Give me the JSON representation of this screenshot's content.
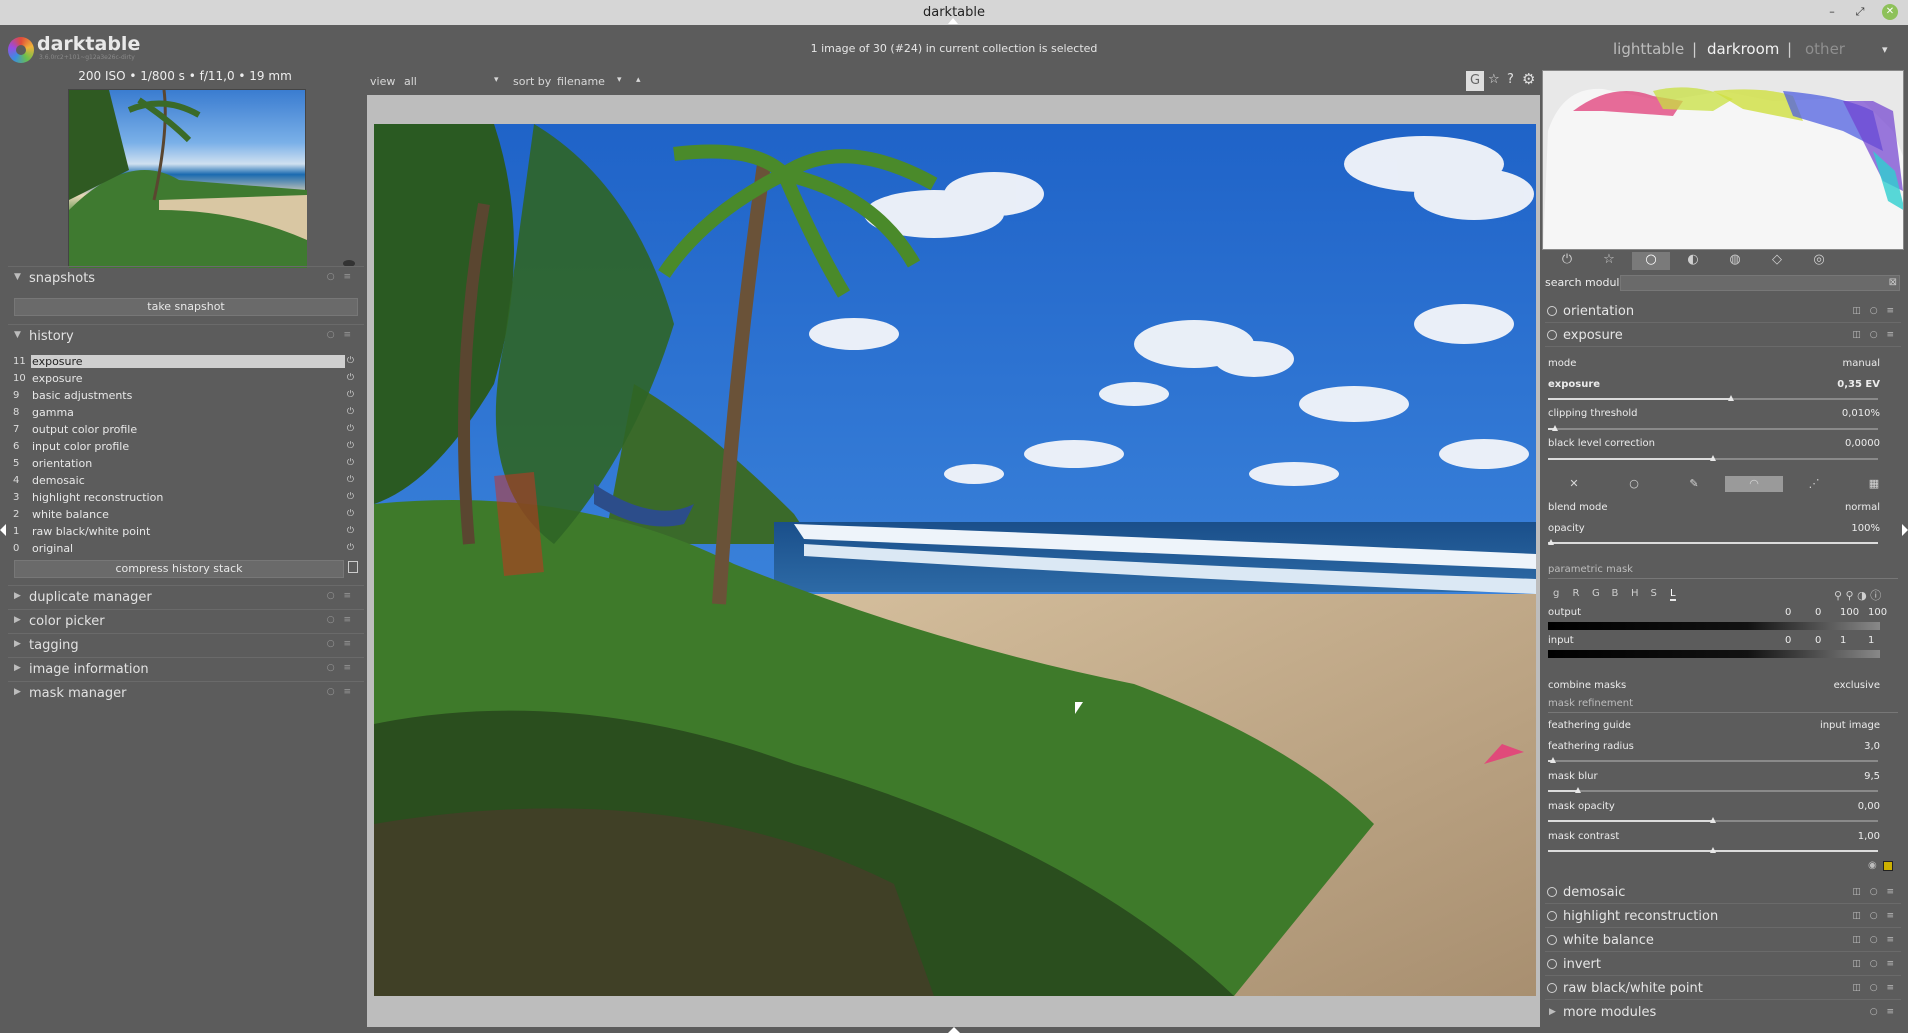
{
  "window": {
    "title": "darktable",
    "min": "–",
    "max": "⤢",
    "close": "✕"
  },
  "header": {
    "app_name": "darktable",
    "version": "3.6.0rc2+101~g12a3e26c-dirty",
    "selection_status": "1 image of 30 (#24) in current collection is selected",
    "views": [
      "lighttable",
      "darkroom",
      "other"
    ],
    "active_view": "darkroom",
    "separator": "|",
    "menu_arrow": "▾"
  },
  "exif": "200 ISO • 1/800 s • f/11,0 • 19 mm",
  "filter_bar": {
    "view_label": "view",
    "view_value": "all",
    "sort_label": "sort by",
    "sort_value": "filename",
    "dd": "▾",
    "sort_dir": "▴"
  },
  "left": {
    "snapshots": {
      "title": "snapshots",
      "take_snapshot": "take snapshot"
    },
    "history": {
      "title": "history",
      "items": [
        {
          "num": "11",
          "name": "exposure",
          "selected": true
        },
        {
          "num": "10",
          "name": "exposure"
        },
        {
          "num": "9",
          "name": "basic adjustments"
        },
        {
          "num": "8",
          "name": "gamma"
        },
        {
          "num": "7",
          "name": "output color profile"
        },
        {
          "num": "6",
          "name": "input color profile"
        },
        {
          "num": "5",
          "name": "orientation"
        },
        {
          "num": "4",
          "name": "demosaic"
        },
        {
          "num": "3",
          "name": "highlight reconstruction"
        },
        {
          "num": "2",
          "name": "white balance"
        },
        {
          "num": "1",
          "name": "raw black/white point"
        },
        {
          "num": "0",
          "name": "original"
        }
      ],
      "compress": "compress history stack"
    },
    "modules": [
      "duplicate manager",
      "color picker",
      "tagging",
      "image information",
      "mask manager"
    ]
  },
  "right": {
    "search_label": "search module",
    "modules_top": [
      "orientation",
      "exposure"
    ],
    "exposure": {
      "mode_label": "mode",
      "mode_value": "manual",
      "exposure_label": "exposure",
      "exposure_value": "0,35 EV",
      "clip_label": "clipping threshold",
      "clip_value": "0,010%",
      "black_label": "black level correction",
      "black_value": "0,0000",
      "blend_label": "blend mode",
      "blend_value": "normal",
      "opacity_label": "opacity",
      "opacity_value": "100%",
      "param_mask": "parametric mask",
      "channels": [
        "g",
        "R",
        "G",
        "B",
        "H",
        "S",
        "L"
      ],
      "output_label": "output",
      "output_vals": [
        "0",
        "0",
        "100",
        "100"
      ],
      "input_label": "input",
      "input_vals": [
        "0",
        "0",
        "1",
        "1"
      ],
      "combine_label": "combine masks",
      "combine_value": "exclusive",
      "refinement": "mask refinement",
      "fguide_label": "feathering guide",
      "fguide_value": "input image",
      "fradius_label": "feathering radius",
      "fradius_value": "3,0",
      "mblur_label": "mask blur",
      "mblur_value": "9,5",
      "mopacity_label": "mask opacity",
      "mopacity_value": "0,00",
      "mcontrast_label": "mask contrast",
      "mcontrast_value": "1,00"
    },
    "modules_bottom": [
      "demosaic",
      "highlight reconstruction",
      "white balance",
      "invert",
      "raw black/white point"
    ],
    "more_modules": "more modules"
  }
}
